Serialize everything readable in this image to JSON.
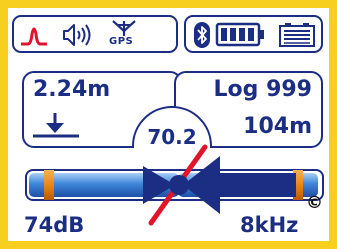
{
  "status_bar": {
    "gps_label": "GPS"
  },
  "depth": {
    "value": "2.24m"
  },
  "log": {
    "label": "Log 999",
    "distance": "104m"
  },
  "gauge": {
    "value": "70.2"
  },
  "bottom": {
    "signal_db": "74dB",
    "frequency": "8kHz",
    "copyright": "©"
  },
  "colors": {
    "border": "#f6cf1f",
    "navy": "#1c2e84",
    "accent_red": "#e0142a",
    "bar_blue": "#3f86d9",
    "bar_orange": "#e88716"
  },
  "icons": [
    "peak-mode-icon",
    "speaker-volume-icon",
    "gps-antenna-icon",
    "bluetooth-icon",
    "battery-icon",
    "storage-battery-icon"
  ]
}
